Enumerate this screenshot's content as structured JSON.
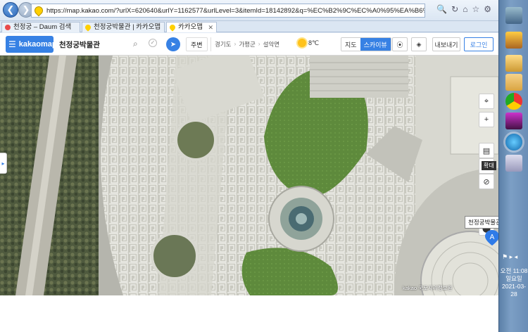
{
  "browser": {
    "url": "https://map.kakao.com/?urlX=620640&urlY=1162577&urlLevel=3&itemId=18142892&q=%EC%B2%9C%EC%A0%95%EA%B6%81%EB%B0%95%EB%AC%BC%EA%B4%80&",
    "tabs": [
      {
        "label": "천정궁 – Daum 검색",
        "icon": "daum-icon",
        "active": false
      },
      {
        "label": "천정궁박물관 | 카카오맵",
        "icon": "kakaomap-icon",
        "active": false
      },
      {
        "label": "카카오맵",
        "icon": "kakaomap-icon",
        "active": true
      }
    ],
    "window_controls": {
      "minimize": "─",
      "maximize": "□",
      "close": "✕"
    }
  },
  "header": {
    "brand": "kakaomap",
    "search_value": "천정궁박물관",
    "nearby_label": "주변",
    "breadcrumb": [
      "경기도",
      "가평군",
      "설악면"
    ],
    "temperature": "8℃",
    "map_types": [
      "지도",
      "스카이뷰"
    ],
    "active_map_type": "스카이뷰",
    "share_label": "내보내기",
    "login_label": "로그인"
  },
  "map": {
    "zoom_tooltip": "확대",
    "poi_label": "천정궁박물관",
    "poi_marker": "A",
    "copyright": "kakao 국토지리정보원"
  },
  "taskbar": {
    "clock_ampm_time": "오전 11:08",
    "clock_day": "일요일",
    "clock_date": "2021-03-28",
    "apps": [
      "image-viewer-icon",
      "photo-icon",
      "folder-icon",
      "chrome-icon",
      "media-icon",
      "ie-icon",
      "paint-icon"
    ]
  }
}
